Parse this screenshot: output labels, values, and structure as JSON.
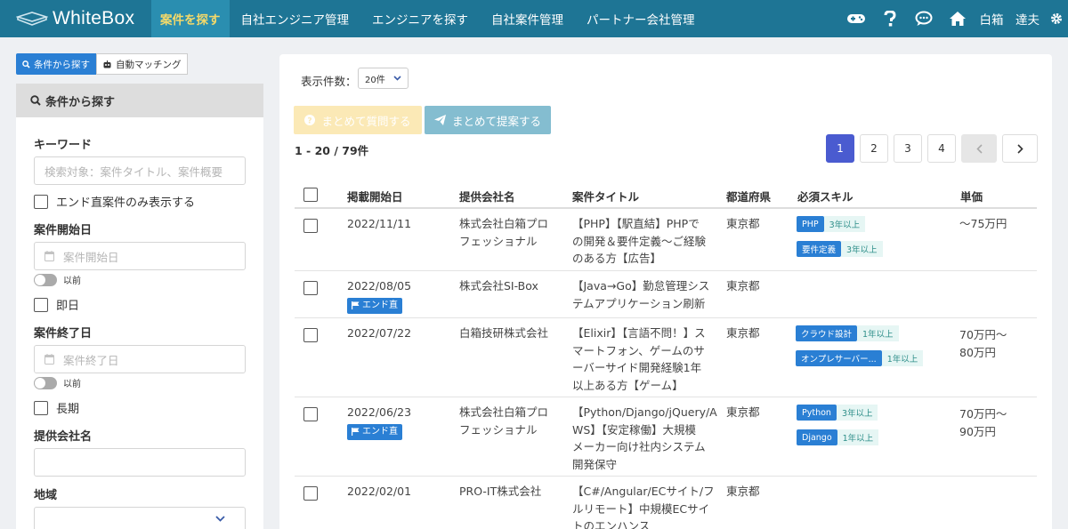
{
  "app": {
    "logo_text": "WhiteBox"
  },
  "nav": {
    "items": [
      "案件を探す",
      "自社エンジニア管理",
      "エンジニアを探す",
      "自社案件管理",
      "パートナー会社管理"
    ],
    "user": "白箱　達夫"
  },
  "sidebar": {
    "mode_tabs": [
      "条件から探す",
      "自動マッチング"
    ],
    "panel_title": "条件から探す",
    "keyword_label": "キーワード",
    "keyword_placeholder": "検索対象：案件タイトル、案件概要",
    "end_only_label": "エンド直案件のみ表示する",
    "start_label": "案件開始日",
    "start_placeholder": "案件開始日",
    "start_toggle": "以前",
    "immediate_label": "即日",
    "end_label": "案件終了日",
    "end_placeholder": "案件終了日",
    "end_toggle": "以前",
    "long_label": "長期",
    "company_label": "提供会社名",
    "region_label": "地域"
  },
  "main": {
    "count_label": "表示件数：",
    "count_value": "20件",
    "btn_question": "まとめて質問する",
    "btn_propose": "まとめて提案する",
    "range_text": "1 - 20 / 79件",
    "pages": [
      "1",
      "2",
      "3",
      "4"
    ],
    "prev": "‹",
    "next": "›"
  },
  "table": {
    "headers": [
      "掲載開始日",
      "提供会社名",
      "案件タイトル",
      "都道府県",
      "必須スキル",
      "単価"
    ],
    "rows": [
      {
        "date": "2022/11/11",
        "end_tag": "",
        "company": [
          "株式会社白箱プロ",
          "フェッショナル"
        ],
        "title": [
          "【PHP】【駅直結】PHPで",
          "の開発＆要件定義～ご経験",
          "のある方【広告】"
        ],
        "pref": "東京都",
        "skills": [
          {
            "name": "PHP",
            "years": "3年以上"
          },
          {
            "name": "要件定義",
            "years": "3年以上"
          }
        ],
        "price": [
          "～75万円"
        ]
      },
      {
        "date": "2022/08/05",
        "end_tag": "エンド直",
        "company": [
          "株式会社SI-Box"
        ],
        "title": [
          "【Java→Go】勤怠管理シス",
          "テムアプリケーション刷新"
        ],
        "pref": "東京都",
        "skills": [],
        "price": []
      },
      {
        "date": "2022/07/22",
        "end_tag": "",
        "company": [
          "白箱技研株式会社"
        ],
        "title": [
          "【Elixir】【言語不問！】ス",
          "マートフォン、ゲームのサ",
          "ーバーサイド開発経験1年",
          "以上ある方【ゲーム】"
        ],
        "pref": "東京都",
        "skills": [
          {
            "name": "クラウド設計",
            "years": "1年以上"
          },
          {
            "name": "オンプレサーバー...",
            "years": "1年以上"
          }
        ],
        "price": [
          "70万円～",
          "80万円"
        ]
      },
      {
        "date": "2022/06/23",
        "end_tag": "エンド直",
        "company": [
          "株式会社白箱プロ",
          "フェッショナル"
        ],
        "title": [
          "【Python/Django/jQuery/A",
          "WS】【安定稼働】大規模",
          "メーカー向け社内システム",
          "開発保守"
        ],
        "pref": "東京都",
        "skills": [
          {
            "name": "Python",
            "years": "3年以上"
          },
          {
            "name": "Django",
            "years": "1年以上"
          }
        ],
        "price": [
          "70万円～",
          "90万円"
        ]
      },
      {
        "date": "2022/02/01",
        "end_tag": "",
        "company": [
          "PRO-IT株式会社"
        ],
        "title": [
          "【C#/Angular/ECサイト/フ",
          "ルリモート】中規模ECサイ",
          "トのエンハンス"
        ],
        "pref": "東京都",
        "skills": [],
        "price": []
      }
    ]
  },
  "colors": {
    "nav_bg": "#1e7595",
    "nav_active_bg": "#2a8eb0",
    "nav_active_text": "#f3d96a",
    "accent": "#2a7fd4",
    "pager_active": "#4a5bd0"
  }
}
